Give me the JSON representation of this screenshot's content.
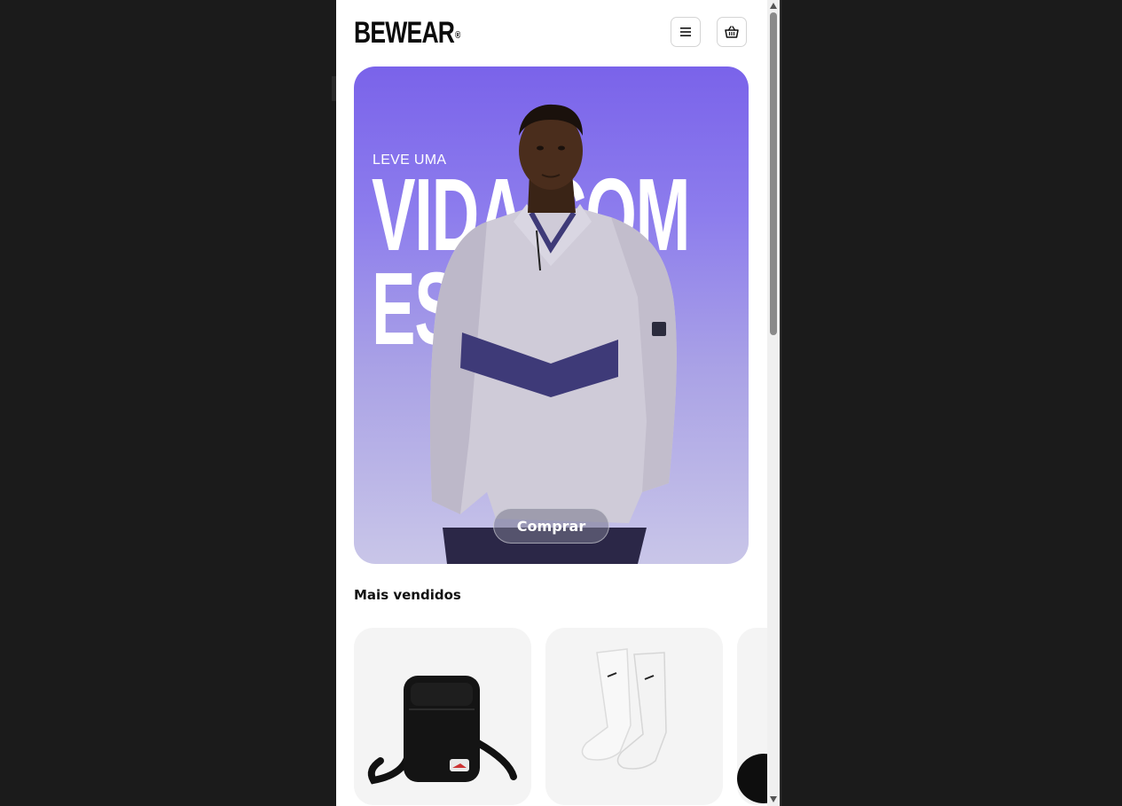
{
  "brand": {
    "name": "BEWEAR",
    "mark": "®"
  },
  "header": {
    "menu_icon": "hamburger-icon",
    "cart_icon": "basket-icon"
  },
  "hero": {
    "subtitle": "LEVE UMA",
    "title": "VIDA COM\nESTILO",
    "cta": "Comprar"
  },
  "best_sellers": {
    "title": "Mais vendidos",
    "items": [
      {
        "image": "black-crossbody-bag"
      },
      {
        "image": "white-crew-socks"
      },
      {
        "image": "black-product-partial"
      }
    ]
  },
  "colors": {
    "hero_top": "#7a63ea",
    "hero_bottom": "#c9c6e8",
    "card_bg": "#f4f4f4",
    "overlay": "#1b1b1b"
  }
}
